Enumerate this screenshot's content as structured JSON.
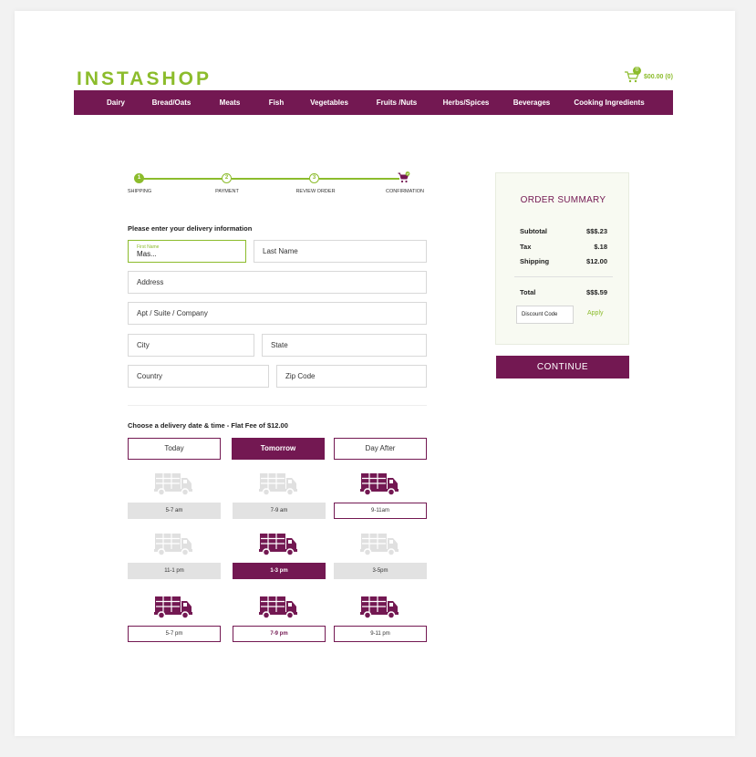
{
  "brand": {
    "logo_text": "INSTASHOP",
    "color": "#8cbc2c"
  },
  "cart": {
    "count": "0",
    "total": "$00.00 (0)",
    "icon": "cart-icon"
  },
  "nav": {
    "color": "#731852",
    "items": [
      "Dairy",
      "Bread/Oats",
      "Meats",
      "Fish",
      "Vegetables",
      "Fruits /Nuts",
      "Herbs/Spices",
      "Beverages",
      "Cooking Ingredients"
    ]
  },
  "stepper": {
    "steps": [
      {
        "label": "SHIPPING",
        "number": "1",
        "active": true
      },
      {
        "label": "PAYMENT",
        "number": "2",
        "active": false
      },
      {
        "label": "REVIEW ORDER",
        "number": "3",
        "active": false
      },
      {
        "label": "CONFIRMATION",
        "icon": "cart-check-icon",
        "active": false
      }
    ]
  },
  "delivery_info": {
    "heading": "Please enter your delivery information",
    "first_name": {
      "label": "First Name",
      "value": "Mas..."
    },
    "last_name": "Last Name",
    "address": "Address",
    "apt": "Apt / Suite / Company",
    "city": "City",
    "state": "State",
    "country": "Country",
    "zip": "Zip Code"
  },
  "delivery_time": {
    "heading": "Choose a delivery date & time - Flat Fee of $12.00",
    "days": [
      {
        "label": "Today",
        "selected": false
      },
      {
        "label": "Tomorrow",
        "selected": true
      },
      {
        "label": "Day After",
        "selected": false
      }
    ],
    "slots": [
      {
        "label": "5-7 am",
        "status": "unavailable"
      },
      {
        "label": "7-9 am",
        "status": "unavailable"
      },
      {
        "label": "9-11am",
        "status": "available"
      },
      {
        "label": "11-1 pm",
        "status": "unavailable"
      },
      {
        "label": "1-3 pm",
        "status": "selected"
      },
      {
        "label": "3-5pm",
        "status": "unavailable"
      },
      {
        "label": "5-7 pm",
        "status": "available"
      },
      {
        "label": "7-9 pm",
        "status": "available"
      },
      {
        "label": "9-11 pm",
        "status": "available"
      }
    ]
  },
  "summary": {
    "title": "ORDER SUMMARY",
    "subtotal_label": "Subtotal",
    "subtotal": "$$$.23",
    "tax_label": "Tax",
    "tax": "$.18",
    "shipping_label": "Shipping",
    "shipping": "$12.00",
    "total_label": "Total",
    "total": "$$$.59",
    "discount_placeholder": "Discount Code",
    "apply_label": "Apply"
  },
  "continue_label": "CONTINUE"
}
